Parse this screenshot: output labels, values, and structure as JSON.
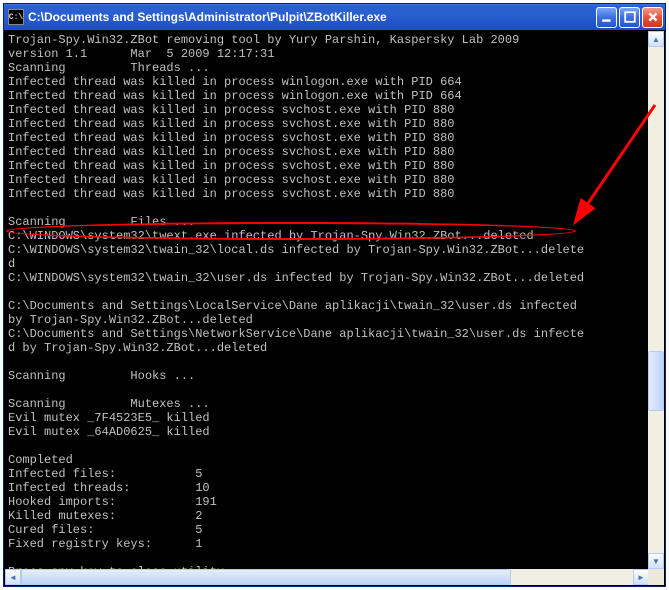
{
  "window": {
    "title": "C:\\Documents and Settings\\Administrator\\Pulpit\\ZBotKiller.exe",
    "icon_label": "C:\\"
  },
  "controls": {
    "minimize": "_",
    "maximize": "□",
    "close": "×"
  },
  "console": {
    "lines": [
      "Trojan-Spy.Win32.ZBot removing tool by Yury Parshin, Kaspersky Lab 2009",
      "version 1.1      Mar  5 2009 12:17:31",
      "Scanning         Threads ...",
      "Infected thread was killed in process winlogon.exe with PID 664",
      "Infected thread was killed in process winlogon.exe with PID 664",
      "Infected thread was killed in process svchost.exe with PID 880",
      "Infected thread was killed in process svchost.exe with PID 880",
      "Infected thread was killed in process svchost.exe with PID 880",
      "Infected thread was killed in process svchost.exe with PID 880",
      "Infected thread was killed in process svchost.exe with PID 880",
      "Infected thread was killed in process svchost.exe with PID 880",
      "Infected thread was killed in process svchost.exe with PID 880",
      "",
      "Scanning         Files ...",
      "C:\\WINDOWS\\system32\\twext.exe infected by Trojan-Spy.Win32.ZBot...deleted",
      "C:\\WINDOWS\\system32\\twain_32\\local.ds infected by Trojan-Spy.Win32.ZBot...delete",
      "d",
      "C:\\WINDOWS\\system32\\twain_32\\user.ds infected by Trojan-Spy.Win32.ZBot...deleted",
      "",
      "C:\\Documents and Settings\\LocalService\\Dane aplikacji\\twain_32\\user.ds infected",
      "by Trojan-Spy.Win32.ZBot...deleted",
      "C:\\Documents and Settings\\NetworkService\\Dane aplikacji\\twain_32\\user.ds infecte",
      "d by Trojan-Spy.Win32.ZBot...deleted",
      "",
      "Scanning         Hooks ...",
      "",
      "Scanning         Mutexes ...",
      "Evil mutex _7F4523E5_ killed",
      "Evil mutex _64AD0625_ killed",
      "",
      "Completed",
      "Infected files:           5",
      "Infected threads:         10",
      "Hooked imports:           191",
      "Killed mutexes:           2",
      "Cured files:              5",
      "Fixed registry keys:      1",
      "",
      "Press any key to close utility..."
    ]
  },
  "annotation": {
    "arrow_color": "#ff0000",
    "ellipse_color": "#ff0000"
  }
}
